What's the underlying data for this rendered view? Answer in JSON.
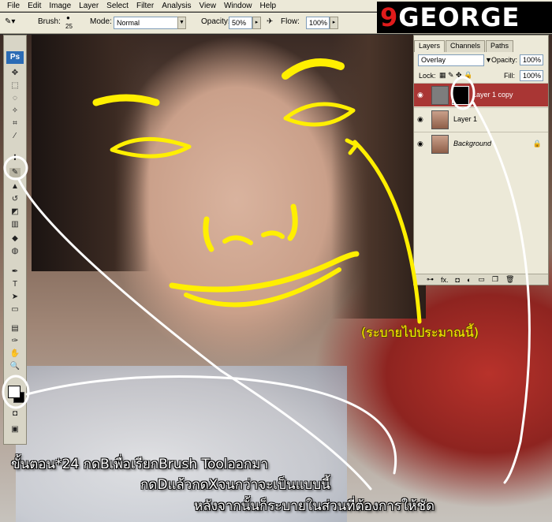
{
  "menu": [
    "File",
    "Edit",
    "Image",
    "Layer",
    "Select",
    "Filter",
    "Analysis",
    "View",
    "Window",
    "Help"
  ],
  "options": {
    "brush_label": "Brush:",
    "brush_size": "25",
    "mode_label": "Mode:",
    "mode_value": "Normal",
    "opacity_label": "Opacity:",
    "opacity_value": "50%",
    "flow_label": "Flow:",
    "flow_value": "100%"
  },
  "logo": {
    "accent": "9",
    "text": "GEORGE",
    "accent_color": "#e01b1b"
  },
  "toolbox": {
    "badge": "Ps"
  },
  "layers_panel": {
    "tabs": [
      "Layers",
      "Channels",
      "Paths"
    ],
    "blend_mode": "Overlay",
    "opacity_label": "Opacity:",
    "opacity_value": "100%",
    "lock_label": "Lock:",
    "fill_label": "Fill:",
    "fill_value": "100%",
    "rows": [
      {
        "name": "Layer 1 copy",
        "selected": true
      },
      {
        "name": "Layer 1",
        "selected": false
      },
      {
        "name": "Background",
        "selected": false
      }
    ],
    "footer": "fx."
  },
  "annotations": {
    "yellow_note": "(ระบายไปประมาณนี้)",
    "line1": "ขั้นตอน*24 กดBเพื่อเรียกBrush Toolออกมา",
    "line2": "กดDแล้วกดXจนกว่าจะเป็นแบบนี้",
    "line3": "หลังจากนั้นก็ระบายในส่วนที่ต้องการให้ชัด"
  },
  "colors": {
    "highlight": "#ffef00",
    "selected_layer": "#a93634"
  }
}
